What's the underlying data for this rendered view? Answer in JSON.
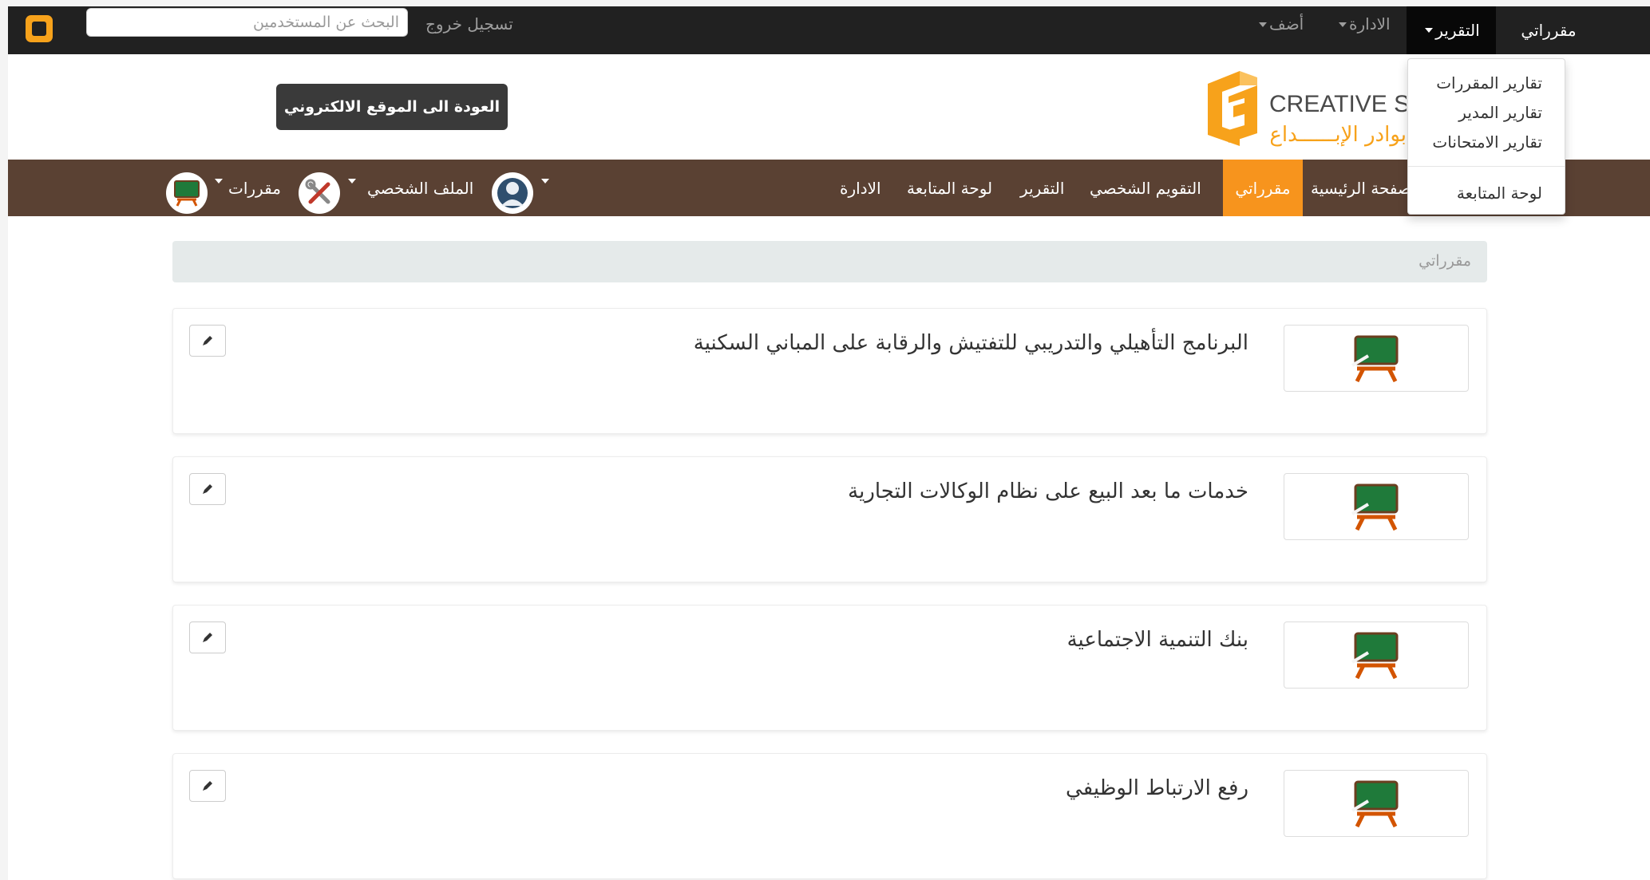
{
  "topbar": {
    "search_placeholder": "البحث عن المستخدمين",
    "logout": "تسجيل خروج",
    "add": "أضف",
    "admin": "الادارة",
    "reports": "التقرير",
    "my_courses": "مقرراتي"
  },
  "reports_menu": {
    "items": [
      "تقارير المقررات",
      "تقارير المدير",
      "تقارير الامتحانات"
    ],
    "dashboard": "لوحة المتابعة"
  },
  "header": {
    "back_button": "العودة الى الموقع الالكتروني",
    "brand_en": "CREATIVE SC",
    "brand_ar": "بوادر الإبــــــداع"
  },
  "mainnav": {
    "home": "الصفحة الرئيسية",
    "my_courses": "مقرراتي",
    "personal_evaluation": "التقويم الشخصي",
    "reports": "التقرير",
    "dashboard": "لوحة المتابعة",
    "admin": "الادارة",
    "profile": "الملف الشخصي",
    "courses": "مقررات"
  },
  "breadcrumb": {
    "current": "مقرراتي"
  },
  "courses": [
    {
      "title": "البرنامج التأهيلي والتدريبي للتفتيش والرقابة على المباني السكنية"
    },
    {
      "title": "خدمات ما بعد البيع على نظام الوكالات التجارية"
    },
    {
      "title": "بنك التنمية الاجتماعية"
    },
    {
      "title": "رفع الارتباط الوظيفي"
    }
  ],
  "icons": {
    "logo": "orange-square-icon",
    "course": "chalkboard-abc-icon",
    "edit": "pencil-icon",
    "user": "user-avatar-icon",
    "tools": "tools-icon"
  },
  "colors": {
    "topbar": "#212121",
    "nav": "#5a4133",
    "accent": "#f7941d",
    "breadcrumb": "#e5eaea"
  }
}
